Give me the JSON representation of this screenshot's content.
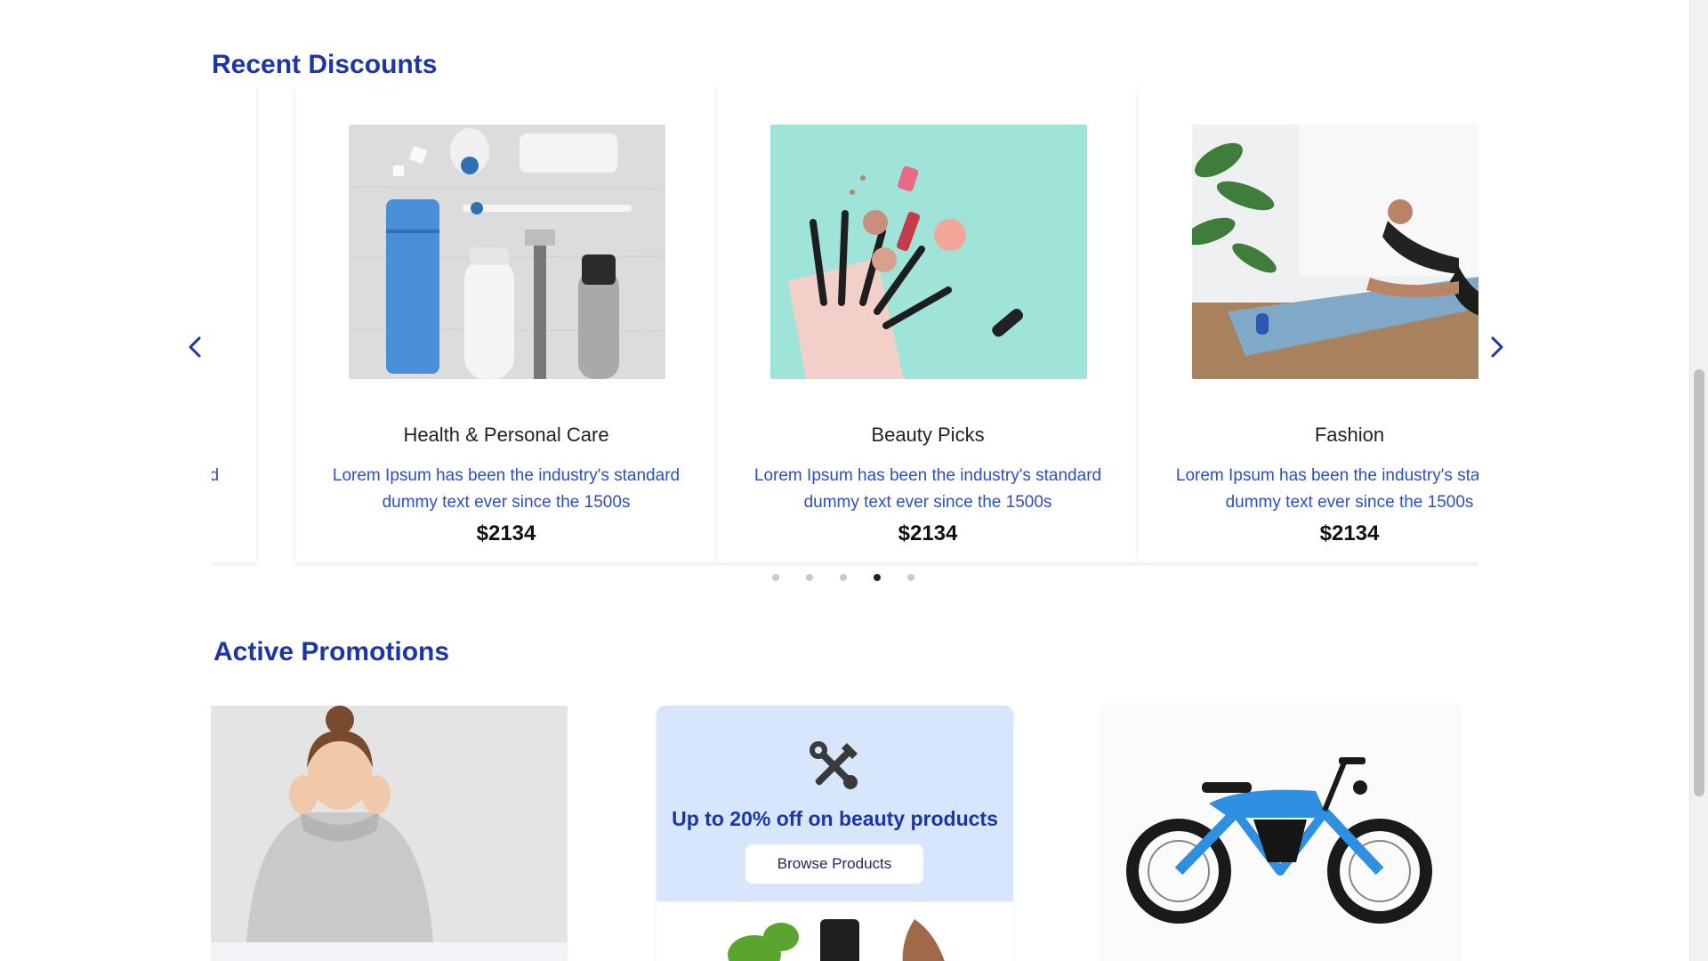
{
  "sections": {
    "recent_discounts_title": "Recent Discounts",
    "active_promotions_title": "Active Promotions"
  },
  "carousel": {
    "cards": [
      {
        "title": "",
        "description": "Lorem Ipsum has been the industry's standard dummy text ever since the 1500s",
        "price": ""
      },
      {
        "title": "Health & Personal Care",
        "description": "Lorem Ipsum has been the industry's standard dummy text ever since the 1500s",
        "price": "$2134"
      },
      {
        "title": "Beauty Picks",
        "description": "Lorem Ipsum has been the industry's standard dummy text ever since the 1500s",
        "price": "$2134"
      },
      {
        "title": "Fashion",
        "description": "Lorem Ipsum has been the industry's standard dummy text ever since the 1500s",
        "price": "$2134"
      }
    ],
    "dots": 5,
    "active_dot": 4,
    "left_arrow_icon": "chevron-left-icon",
    "right_arrow_icon": "chevron-right-icon"
  },
  "promotions": {
    "promo_2": {
      "icon": "tools-icon",
      "text": "Up to 20% off on beauty products",
      "button_label": "Browse Products"
    }
  },
  "colors": {
    "accent": "#1c35a8",
    "link_text": "#2d4fc4",
    "promo_bg": "#d8e6fb"
  }
}
